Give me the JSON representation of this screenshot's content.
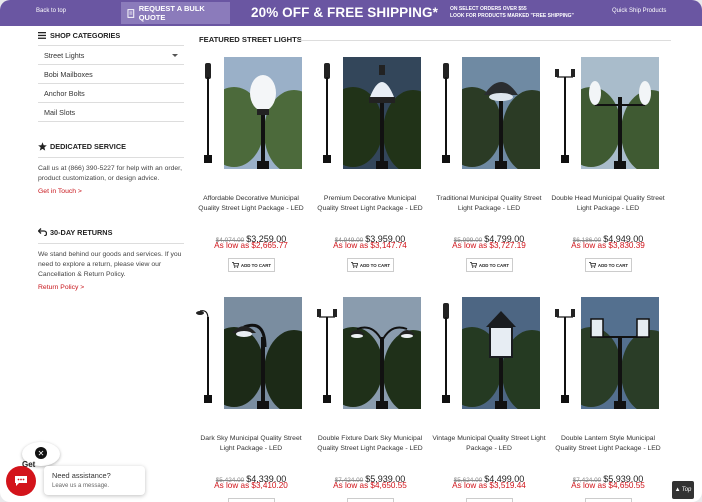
{
  "topbar": {
    "back_label": "Back to top",
    "bulk_label": "REQUEST A BULK QUOTE",
    "promo": "20% OFF & FREE SHIPPING*",
    "promo_sub1": "ON SELECT ORDERS OVER $55",
    "promo_sub2": "LOOK FOR PRODUCTS MARKED \"FREE SHIPPING\"",
    "quick_label": "Quick Ship Products"
  },
  "sidebar": {
    "categories_title": "SHOP CATEGORIES",
    "categories": [
      {
        "label": "Street Lights"
      },
      {
        "label": "Bobi Mailboxes"
      },
      {
        "label": "Anchor Bolts"
      },
      {
        "label": "Mail Slots"
      }
    ],
    "service_title": "DEDICATED SERVICE",
    "service_text": "Call us at (866) 390-5227 for help with an order, product customization, or design advice.",
    "service_link": "Get in Touch >",
    "returns_title": "30-DAY RETURNS",
    "returns_text": "We stand behind our goods and services. If you need to explore a return, please view our Cancellation & Return Policy.",
    "returns_link": "Return Policy >"
  },
  "main": {
    "section_title": "FEATURED STREET LIGHTS",
    "add_to_cart": "ADD TO CART",
    "products": [
      {
        "name": "Affordable Decorative Municipal Quality Street Light Package - LED",
        "old": "$4,074.00",
        "price": "$3,259.00",
        "low": "As low as $2,665.77"
      },
      {
        "name": "Premium Decorative Municipal Quality Street Light Package - LED",
        "old": "$4,949.00",
        "price": "$3,959.00",
        "low": "As low as $3,147.74"
      },
      {
        "name": "Traditional Municipal Quality Street Light Package - LED",
        "old": "$5,999.00",
        "price": "$4,799.00",
        "low": "As low as $3,727.19"
      },
      {
        "name": "Double Head Municipal Quality Street Light Package - LED",
        "old": "$6,186.00",
        "price": "$4,949.00",
        "low": "As low as $3,830.39"
      },
      {
        "name": "Dark Sky Municipal Quality Street Light Package - LED",
        "old": "$5,424.00",
        "price": "$4,339.00",
        "low": "As low as $3,410.20"
      },
      {
        "name": "Double Fixture Dark Sky Municipal Quality Street Light Package - LED",
        "old": "$7,424.00",
        "price": "$5,939.00",
        "low": "As low as $4,650.55"
      },
      {
        "name": "Vintage Municipal Quality Street Light Package - LED",
        "old": "$5,624.00",
        "price": "$4,499.00",
        "low": "As low as $3,519.44"
      },
      {
        "name": "Double Lantern Style Municipal Quality Street Light Package - LED",
        "old": "$7,424.00",
        "price": "$5,939.00",
        "low": "As low as $4,650.55"
      }
    ]
  },
  "chat": {
    "get_text": "Get",
    "need_help": "Need assistance?",
    "leave_msg": "Leave us a message."
  },
  "top_button": "Top",
  "colors": {
    "brand_purple": "#6a56a2",
    "sale_red": "#d0141a",
    "accent_red": "#c8151b"
  }
}
